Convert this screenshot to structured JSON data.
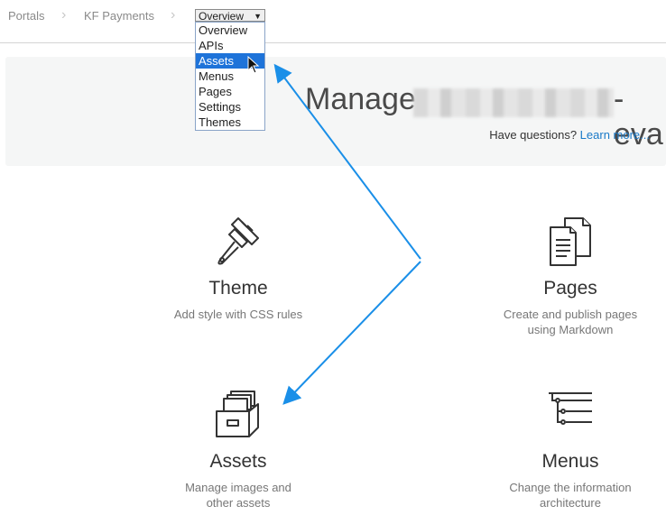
{
  "breadcrumb": {
    "items": [
      "Portals",
      "KF Payments"
    ],
    "select_value": "Overview"
  },
  "dropdown": {
    "options": [
      "Overview",
      "APIs",
      "Assets",
      "Menus",
      "Pages",
      "Settings",
      "Themes"
    ],
    "selected": "Assets"
  },
  "hero": {
    "title_prefix": "Manage",
    "title_suffix": "-eva",
    "help_text": "Have questions?",
    "help_link": "Learn more..."
  },
  "cards": {
    "theme": {
      "title": "Theme",
      "desc": "Add style with CSS rules",
      "icon": "paintbrush-icon"
    },
    "pages": {
      "title": "Pages",
      "desc_line1": "Create and publish pages",
      "desc_line2": "using Markdown",
      "icon": "documents-icon"
    },
    "assets": {
      "title": "Assets",
      "desc_line1": "Manage images and",
      "desc_line2": "other assets",
      "icon": "file-drawer-icon"
    },
    "menus": {
      "title": "Menus",
      "desc_line1": "Change the information",
      "desc_line2": "architecture",
      "icon": "menu-tree-icon"
    }
  },
  "colors": {
    "accent": "#1a7ac8",
    "selection": "#1e73d9",
    "annotation_arrow": "#1a8fe8"
  }
}
